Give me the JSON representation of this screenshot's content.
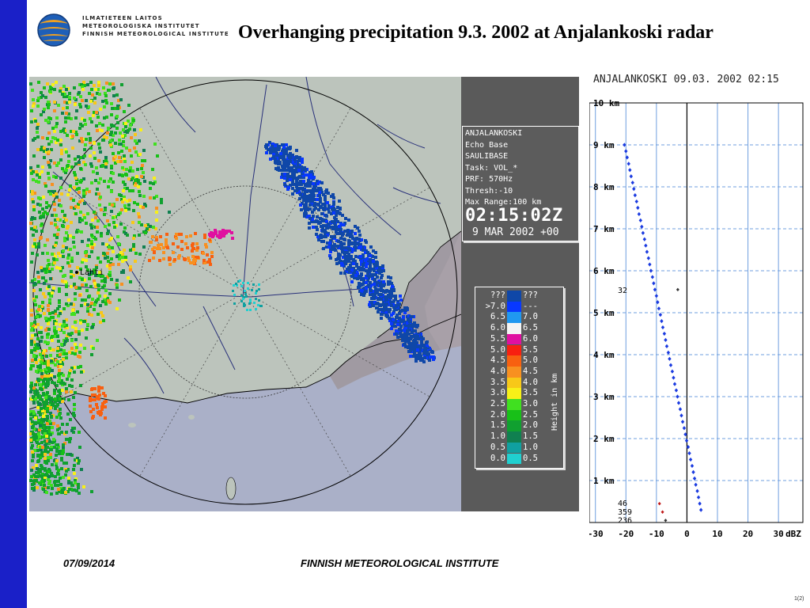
{
  "slide": {
    "title": "Overhanging precipitation 9.3. 2002 at Anjalankoski radar",
    "footer_date": "07/09/2014",
    "footer_org": "FINNISH METEOROLOGICAL INSTITUTE",
    "page_number": "1(2)"
  },
  "logo": {
    "line1": "ILMATIETEEN LAITOS",
    "line2": "METEOROLOGISKA INSTITUTET",
    "line3": "FINNISH METEOROLOGICAL INSTITUTE"
  },
  "radar": {
    "info_lines": [
      "ANJALANKOSKI",
      "Echo Base",
      "SAULIBASE",
      "Task: VOL_*",
      "PRF: 570Hz",
      "Thresh:-10",
      "Max Range:100 km"
    ],
    "time": "02:15:02Z",
    "date": "9 MAR 2002 +00",
    "city_label": "Lahti",
    "legend_title": "Height in km",
    "legend": [
      {
        "left": "???",
        "right": "???",
        "color": "#0f47a8"
      },
      {
        "left": ">7.0",
        "right": "---",
        "color": "#0838ff"
      },
      {
        "left": "6.5",
        "right": "7.0",
        "color": "#2098f0"
      },
      {
        "left": "6.0",
        "right": "6.5",
        "color": "#f4f4f4"
      },
      {
        "left": "5.5",
        "right": "6.0",
        "color": "#e010a0"
      },
      {
        "left": "5.0",
        "right": "5.5",
        "color": "#f82010"
      },
      {
        "left": "4.5",
        "right": "5.0",
        "color": "#f86010"
      },
      {
        "left": "4.0",
        "right": "4.5",
        "color": "#f89020"
      },
      {
        "left": "3.5",
        "right": "4.0",
        "color": "#f8c818"
      },
      {
        "left": "3.0",
        "right": "3.5",
        "color": "#f8f018"
      },
      {
        "left": "2.5",
        "right": "3.0",
        "color": "#40e020"
      },
      {
        "left": "2.0",
        "right": "2.5",
        "color": "#18c018"
      },
      {
        "left": "1.5",
        "right": "2.0",
        "color": "#10a030"
      },
      {
        "left": "1.0",
        "right": "1.5",
        "color": "#108050"
      },
      {
        "left": "0.5",
        "right": "1.0",
        "color": "#10a0a0"
      },
      {
        "left": "0.0",
        "right": "0.5",
        "color": "#20d0d0"
      }
    ]
  },
  "profile": {
    "header": "ANJALANKOSKI 09.03. 2002 02:15",
    "y_labels": [
      "10 km",
      "9 km",
      "8 km",
      "7 km",
      "6 km",
      "5 km",
      "4 km",
      "3 km",
      "2 km",
      "1 km"
    ],
    "x_labels": [
      "-30",
      "-20",
      "-10",
      "0",
      "10",
      "20",
      "30",
      "dBZ"
    ],
    "annotations": [
      "32",
      "46",
      "359",
      "236"
    ],
    "colors": {
      "series": "#1a3ae0",
      "grid": "#6f9fdf",
      "axis": "#000000"
    }
  },
  "chart_data": {
    "type": "scatter",
    "title": "ANJALANKOSKI 09.03. 2002 02:15",
    "xlabel": "dBZ",
    "ylabel": "",
    "xlim": [
      -32,
      38
    ],
    "ylim": [
      0,
      10
    ],
    "x_ticks": [
      -30,
      -20,
      -10,
      0,
      10,
      20,
      30
    ],
    "y_ticks": [
      1,
      2,
      3,
      4,
      5,
      6,
      7,
      8,
      9,
      10
    ],
    "grid": true,
    "series": [
      {
        "name": "",
        "points": [
          [
            -20.5,
            9.0
          ],
          [
            -20.0,
            8.85
          ],
          [
            -19.6,
            8.7
          ],
          [
            -19.1,
            8.55
          ],
          [
            -18.7,
            8.4
          ],
          [
            -18.3,
            8.25
          ],
          [
            -17.8,
            8.1
          ],
          [
            -17.4,
            7.95
          ],
          [
            -17.0,
            7.8
          ],
          [
            -16.5,
            7.65
          ],
          [
            -16.1,
            7.5
          ],
          [
            -15.7,
            7.35
          ],
          [
            -15.2,
            7.2
          ],
          [
            -14.8,
            7.05
          ],
          [
            -14.4,
            6.9
          ],
          [
            -13.9,
            6.75
          ],
          [
            -13.5,
            6.6
          ],
          [
            -13.1,
            6.45
          ],
          [
            -12.6,
            6.3
          ],
          [
            -12.2,
            6.15
          ],
          [
            -11.8,
            6.0
          ],
          [
            -11.3,
            5.85
          ],
          [
            -10.9,
            5.7
          ],
          [
            -10.5,
            5.55
          ],
          [
            -10.0,
            5.4
          ],
          [
            -9.6,
            5.25
          ],
          [
            -9.2,
            5.1
          ],
          [
            -8.7,
            4.95
          ],
          [
            -8.3,
            4.8
          ],
          [
            -7.9,
            4.65
          ],
          [
            -7.4,
            4.5
          ],
          [
            -7.0,
            4.35
          ],
          [
            -6.6,
            4.2
          ],
          [
            -6.1,
            4.05
          ],
          [
            -5.7,
            3.9
          ],
          [
            -5.3,
            3.75
          ],
          [
            -4.8,
            3.6
          ],
          [
            -4.4,
            3.45
          ],
          [
            -4.0,
            3.3
          ],
          [
            -3.5,
            3.15
          ],
          [
            -3.1,
            3.0
          ],
          [
            -2.7,
            2.85
          ],
          [
            -2.2,
            2.7
          ],
          [
            -1.8,
            2.55
          ],
          [
            -1.4,
            2.4
          ],
          [
            -0.9,
            2.25
          ],
          [
            -0.5,
            2.1
          ],
          [
            -0.1,
            1.95
          ],
          [
            0.4,
            1.8
          ],
          [
            0.8,
            1.65
          ],
          [
            1.2,
            1.5
          ],
          [
            1.7,
            1.35
          ],
          [
            2.1,
            1.2
          ],
          [
            2.5,
            1.05
          ],
          [
            2.9,
            0.9
          ],
          [
            3.4,
            0.75
          ],
          [
            3.8,
            0.6
          ],
          [
            4.2,
            0.45
          ],
          [
            4.6,
            0.3
          ]
        ]
      }
    ],
    "markers": [
      {
        "label": "32",
        "x": -3,
        "y": 5.55
      },
      {
        "label": "46",
        "x": -9,
        "y": 0.45
      },
      {
        "label": "359",
        "x": -8,
        "y": 0.25
      },
      {
        "label": "236",
        "x": -7,
        "y": 0.05
      }
    ]
  }
}
